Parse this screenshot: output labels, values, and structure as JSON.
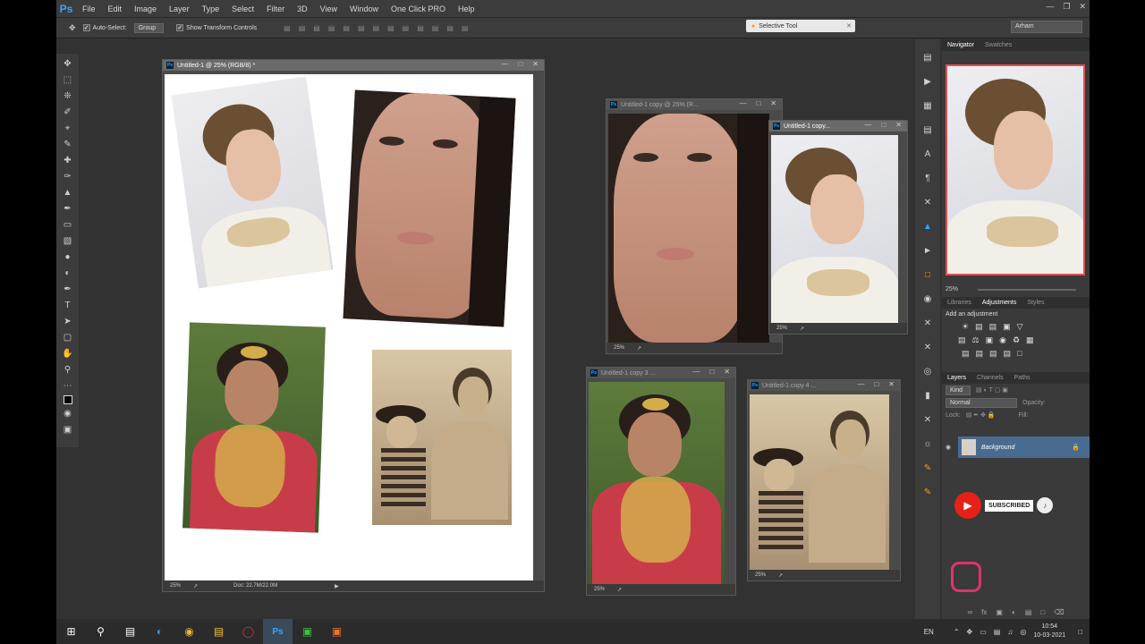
{
  "menu": [
    "File",
    "Edit",
    "Image",
    "Layer",
    "Type",
    "Select",
    "Filter",
    "3D",
    "View",
    "Window",
    "One Click PRO",
    "Help"
  ],
  "options": {
    "auto_select": "Auto-Select:",
    "auto_select_value": "Group",
    "show_transform": "Show Transform Controls"
  },
  "selective_tool": "Selective Tool",
  "workspace": "Arham",
  "docs": {
    "main": {
      "title": "Untitled-1 @ 25% (RGB/8) *",
      "zoom": "25%",
      "docsize": "Doc: 22.7M/22.0M"
    },
    "copy1": {
      "title": "Untitled-1 copy @ 25% (R...",
      "zoom": "25%"
    },
    "copy2": {
      "title": "Untitled-1 copy...",
      "zoom": "25%"
    },
    "copy3": {
      "title": "Untitled-1 copy 3 ...",
      "zoom": "25%"
    },
    "copy4": {
      "title": "Untitled-1 copy 4 ...",
      "zoom": "25%"
    }
  },
  "panels": {
    "nav_tabs": [
      "Navigator",
      "Swatches"
    ],
    "nav_zoom": "25%",
    "adj_tabs": [
      "Libraries",
      "Adjustments",
      "Styles"
    ],
    "adj_title": "Add an adjustment",
    "layer_tabs": [
      "Layers",
      "Channels",
      "Paths"
    ],
    "kind": "Kind",
    "blend": "Normal",
    "opacity": "Opacity:",
    "lock": "Lock:",
    "fill": "Fill:",
    "layer_name": "Background"
  },
  "subscribe": "SUBSCRIBED",
  "taskbar": {
    "lang": "EN",
    "time": "10:54",
    "date": "10-03-2021"
  },
  "colors": {
    "ps_blue": "#31a8ff",
    "layer_selected": "#4a6b90",
    "youtube_red": "#e62117"
  }
}
